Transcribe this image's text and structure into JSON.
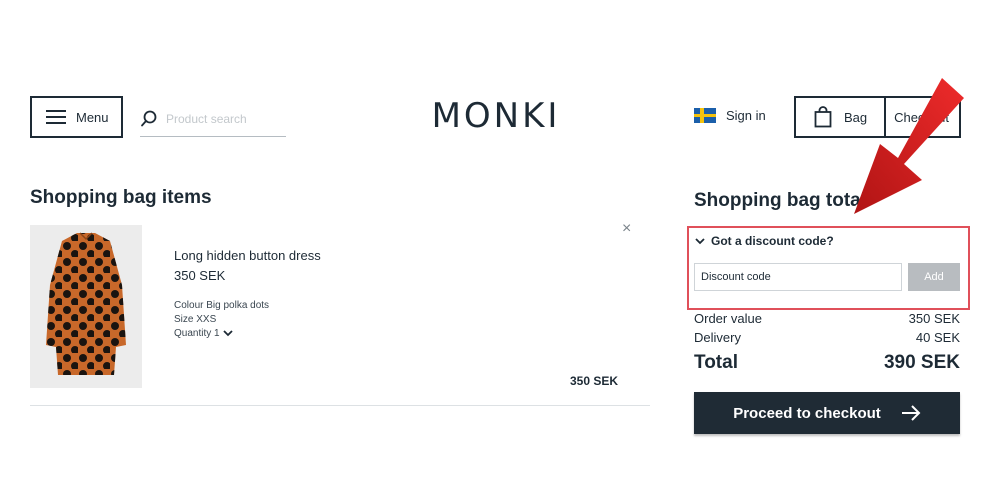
{
  "header": {
    "menu_label": "Menu",
    "search_placeholder": "Product search",
    "logo": "MONKI",
    "signin_label": "Sign in",
    "bag_label": "Bag",
    "checkout_label": "Checkout"
  },
  "items_section": {
    "title": "Shopping bag items",
    "items": [
      {
        "name": "Long hidden button dress",
        "price": "350 SEK",
        "colour": "Colour Big polka dots",
        "size": "Size XXS",
        "quantity": "Quantity 1",
        "line_total": "350 SEK"
      }
    ]
  },
  "summary": {
    "title": "Shopping bag total",
    "discount_toggle": "Got a discount code?",
    "discount_placeholder": "Discount code",
    "add_label": "Add",
    "order_value_label": "Order value",
    "order_value": "350 SEK",
    "delivery_label": "Delivery",
    "delivery": "40 SEK",
    "total_label": "Total",
    "total": "390 SEK",
    "proceed_label": "Proceed to checkout"
  },
  "colors": {
    "primary": "#1f2b35",
    "highlight_border": "#e0505a",
    "arrow": "#d42222",
    "dress": "#c8682a"
  }
}
